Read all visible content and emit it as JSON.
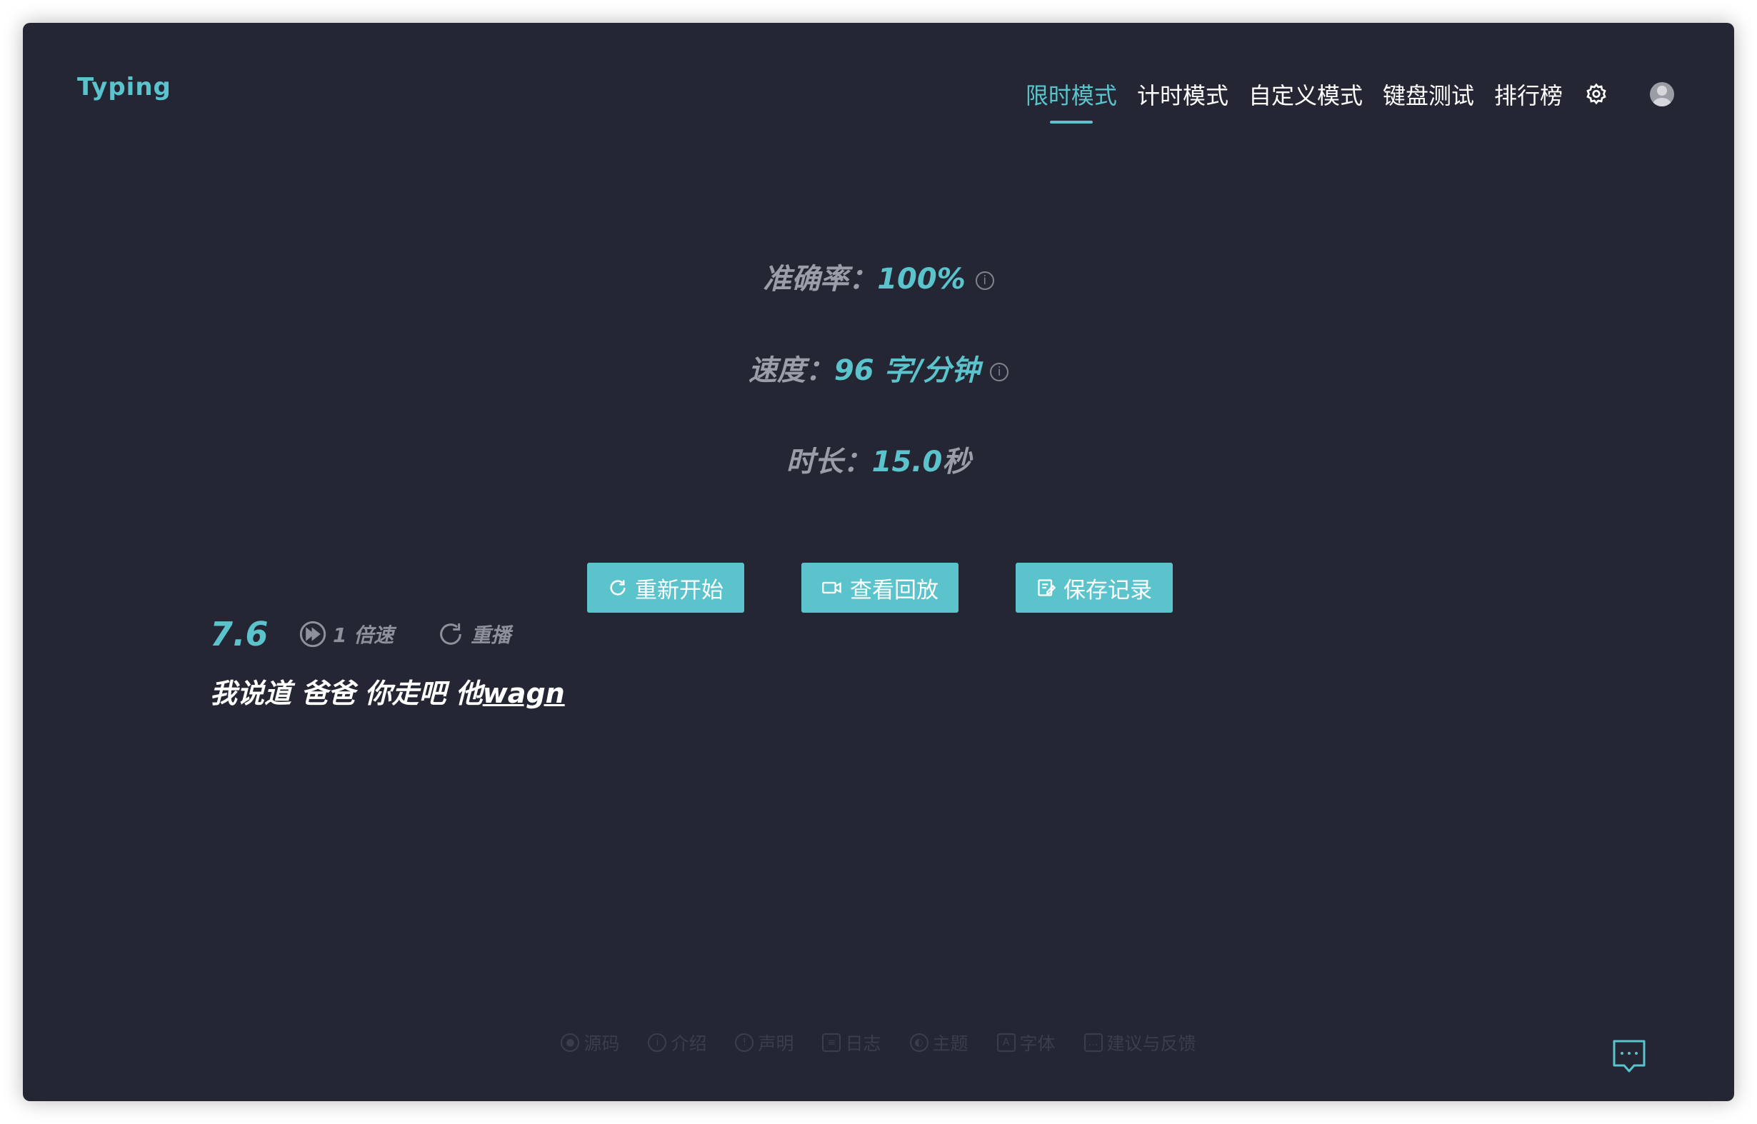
{
  "app": {
    "logo": "Typing"
  },
  "nav": {
    "items": [
      {
        "label": "限时模式",
        "active": true
      },
      {
        "label": "计时模式",
        "active": false
      },
      {
        "label": "自定义模式",
        "active": false
      },
      {
        "label": "键盘测试",
        "active": false
      },
      {
        "label": "排行榜",
        "active": false
      }
    ],
    "settings_icon": "gear-icon",
    "avatar_icon": "user-avatar"
  },
  "stats": {
    "accuracy": {
      "label": "准确率：",
      "value": "100%"
    },
    "speed": {
      "label": "速度：",
      "value": "96 字/分钟"
    },
    "duration": {
      "label": "时长：",
      "value": "15.0",
      "unit": "秒"
    }
  },
  "buttons": {
    "restart": "重新开始",
    "replay": "查看回放",
    "save": "保存记录"
  },
  "replay": {
    "time": "7.6",
    "speed_label": "1 倍速",
    "replay_label": "重播",
    "text_typed": "我说道 爸爸 你走吧 他",
    "text_current": "wagn"
  },
  "footer": {
    "items": [
      {
        "label": "源码",
        "icon": "github-icon"
      },
      {
        "label": "介绍",
        "icon": "info-icon"
      },
      {
        "label": "声明",
        "icon": "shield-icon"
      },
      {
        "label": "日志",
        "icon": "calendar-icon"
      },
      {
        "label": "主题",
        "icon": "palette-icon"
      },
      {
        "label": "字体",
        "icon": "font-icon"
      },
      {
        "label": "建议与反馈",
        "icon": "feedback-icon"
      }
    ]
  },
  "colors": {
    "accent": "#5bc3cc",
    "background": "#242633",
    "muted": "#9a9ea8",
    "footer": "#3a3e4b"
  }
}
